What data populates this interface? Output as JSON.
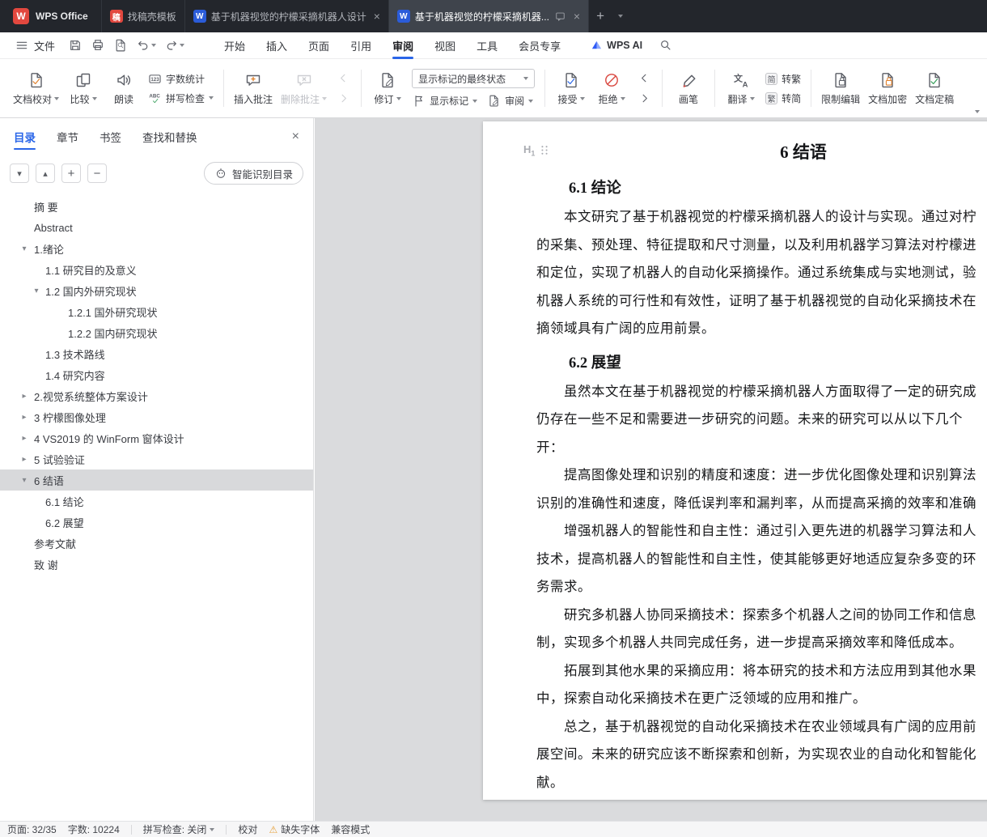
{
  "icons": {
    "close": "×",
    "plus": "+",
    "minus": "−",
    "tri_down": "▾",
    "tri_up": "▴",
    "tri_right": "▸",
    "warning": "⚠",
    "wps_w": "W",
    "word_w": "W",
    "tmpl_glyph": "稿"
  },
  "colors": {
    "accent_blue": "#2a66e8",
    "wps_red": "#e2483f",
    "word_blue": "#2b5cd9",
    "warning": "#e6a23c",
    "selected_toc_bg": "#d8d9db"
  },
  "tabbar": {
    "home": "WPS Office",
    "tabs": [
      {
        "title": "找稿壳模板"
      },
      {
        "title": "基于机器视觉的柠檬采摘机器人设计"
      },
      {
        "title": "基于机器视觉的柠檬采摘机器..."
      }
    ]
  },
  "menubar": {
    "file": "文件",
    "items": [
      "开始",
      "插入",
      "页面",
      "引用",
      "审阅",
      "视图",
      "工具",
      "会员专享"
    ],
    "active": "审阅",
    "wps_ai": "WPS AI"
  },
  "ribbon": {
    "doc_proof": "文档校对",
    "compare": "比较",
    "read_aloud": "朗读",
    "word_count": "字数统计",
    "spell_check": "拼写检查",
    "insert_comment": "插入批注",
    "delete_comment": "删除批注",
    "revise": "修订",
    "markup_state": "显示标记的最终状态",
    "show_markup": "显示标记",
    "review": "审阅",
    "accept": "接受",
    "reject": "拒绝",
    "brush": "画笔",
    "translate": "翻译",
    "jian": "简",
    "fan": "繁",
    "to_trad": "转繁",
    "to_simp": "转简",
    "restrict": "限制编辑",
    "encrypt": "文档加密",
    "finalize": "文档定稿"
  },
  "sidebar": {
    "tabs": [
      "目录",
      "章节",
      "书签",
      "查找和替换"
    ],
    "active_tab": "目录",
    "smart_toc": "智能识别目录",
    "toc": [
      {
        "label": "摘 要",
        "level": 0
      },
      {
        "label": "Abstract",
        "level": 0
      },
      {
        "label": "1.绪论",
        "level": 0,
        "arrow": "down"
      },
      {
        "label": "1.1 研究目的及意义",
        "level": 1
      },
      {
        "label": "1.2 国内外研究现状",
        "level": 1,
        "arrow": "down"
      },
      {
        "label": "1.2.1 国外研究现状",
        "level": 2
      },
      {
        "label": "1.2.2 国内研究现状",
        "level": 2
      },
      {
        "label": "1.3 技术路线",
        "level": 1
      },
      {
        "label": "1.4 研究内容",
        "level": 1
      },
      {
        "label": "2.视觉系统整体方案设计",
        "level": 0,
        "arrow": "right"
      },
      {
        "label": "3 柠檬图像处理",
        "level": 0,
        "arrow": "right"
      },
      {
        "label": "4 VS2019 的 WinForm 窗体设计",
        "level": 0,
        "arrow": "right"
      },
      {
        "label": "5 试验验证",
        "level": 0,
        "arrow": "right"
      },
      {
        "label": "6 结语",
        "level": 0,
        "arrow": "down",
        "selected": true
      },
      {
        "label": "6.1 结论",
        "level": 1
      },
      {
        "label": "6.2 展望",
        "level": 1
      },
      {
        "label": "参考文献",
        "level": 0
      },
      {
        "label": "致 谢",
        "level": 0
      }
    ]
  },
  "document": {
    "marker_h": "H",
    "marker_sub": "1",
    "title": "6 结语",
    "sections": [
      {
        "heading": "6.1 结论",
        "lines": [
          "　　本文研究了基于机器视觉的柠檬采摘机器人的设计与实现。通过对柠",
          "的采集、预处理、特征提取和尺寸测量，以及利用机器学习算法对柠檬进",
          "和定位，实现了机器人的自动化采摘操作。通过系统集成与实地测试，验",
          "机器人系统的可行性和有效性，证明了基于机器视觉的自动化采摘技术在",
          "摘领域具有广阔的应用前景。"
        ]
      },
      {
        "heading": "6.2 展望",
        "lines": [
          "　　虽然本文在基于机器视觉的柠檬采摘机器人方面取得了一定的研究成",
          "仍存在一些不足和需要进一步研究的问题。未来的研究可以从以下几个",
          "开：",
          "　　提高图像处理和识别的精度和速度：进一步优化图像处理和识别算法",
          "识别的准确性和速度，降低误判率和漏判率，从而提高采摘的效率和准确",
          "　　增强机器人的智能性和自主性：通过引入更先进的机器学习算法和人",
          "技术，提高机器人的智能性和自主性，使其能够更好地适应复杂多变的环",
          "务需求。",
          "　　研究多机器人协同采摘技术：探索多个机器人之间的协同工作和信息",
          "制，实现多个机器人共同完成任务，进一步提高采摘效率和降低成本。",
          "　　拓展到其他水果的采摘应用：将本研究的技术和方法应用到其他水果",
          "中，探索自动化采摘技术在更广泛领域的应用和推广。",
          "　　总之，基于机器视觉的自动化采摘技术在农业领域具有广阔的应用前",
          "展空间。未来的研究应该不断探索和创新，为实现农业的自动化和智能化",
          "献。"
        ]
      }
    ]
  },
  "statusbar": {
    "page": "页面: 32/35",
    "words": "字数: 10224",
    "spell": "拼写检查: 关闭",
    "proof": "校对",
    "missing_font": "缺失字体",
    "compat": "兼容模式"
  }
}
